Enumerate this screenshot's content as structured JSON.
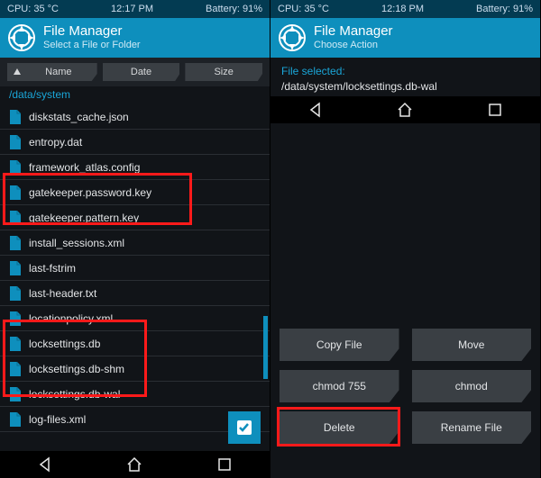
{
  "left": {
    "status": {
      "cpu": "CPU: 35 °C",
      "time": "12:17 PM",
      "battery": "Battery: 91%"
    },
    "header": {
      "title": "File Manager",
      "sub": "Select a File or Folder"
    },
    "sort": {
      "name": "Name",
      "date": "Date",
      "size": "Size"
    },
    "path": "/data/system",
    "files": [
      "diskstats_cache.json",
      "entropy.dat",
      "framework_atlas.config",
      "gatekeeper.password.key",
      "gatekeeper.pattern.key",
      "install_sessions.xml",
      "last-fstrim",
      "last-header.txt",
      "locationpolicy.xml",
      "locksettings.db",
      "locksettings.db-shm",
      "locksettings.db-wal",
      "log-files.xml"
    ]
  },
  "right": {
    "status": {
      "cpu": "CPU: 35 °C",
      "time": "12:18 PM",
      "battery": "Battery: 91%"
    },
    "header": {
      "title": "File Manager",
      "sub": "Choose Action"
    },
    "selected_label": "File selected:",
    "selected_path": "/data/system/locksettings.db-wal",
    "actions": {
      "copy": "Copy File",
      "move": "Move",
      "chmod755": "chmod 755",
      "chmod": "chmod",
      "delete": "Delete",
      "rename": "Rename File"
    }
  }
}
